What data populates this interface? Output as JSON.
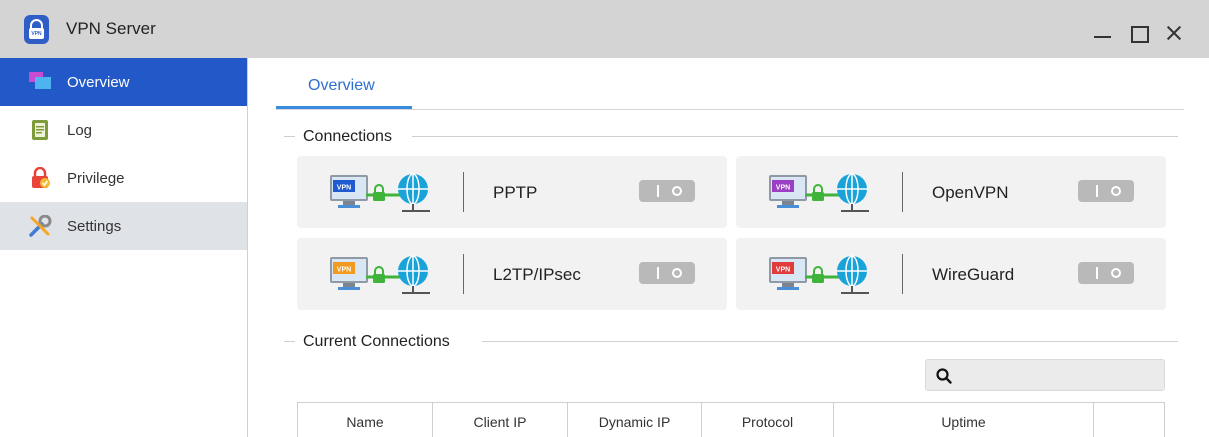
{
  "window": {
    "title": "VPN Server",
    "app_icon_text": "VPN"
  },
  "sidebar": {
    "items": [
      {
        "label": "Overview",
        "icon": "overview-icon",
        "state": "active"
      },
      {
        "label": "Log",
        "icon": "log-icon",
        "state": "normal"
      },
      {
        "label": "Privilege",
        "icon": "privilege-icon",
        "state": "normal"
      },
      {
        "label": "Settings",
        "icon": "settings-icon",
        "state": "hover"
      }
    ]
  },
  "tabs": [
    {
      "label": "Overview",
      "active": true
    }
  ],
  "connections": {
    "title": "Connections",
    "items": [
      {
        "protocol": "PPTP",
        "badge_text": "VPN",
        "badge_color": "#1f5bd0",
        "enabled": false
      },
      {
        "protocol": "OpenVPN",
        "badge_text": "VPN",
        "badge_color": "#9b3fc4",
        "enabled": false
      },
      {
        "protocol": "L2TP/IPsec",
        "badge_text": "VPN",
        "badge_color": "#f29a1f",
        "enabled": false
      },
      {
        "protocol": "WireGuard",
        "badge_text": "VPN",
        "badge_color": "#e23b3b",
        "enabled": false
      }
    ]
  },
  "current_connections": {
    "title": "Current Connections",
    "search": {
      "value": "",
      "placeholder": ""
    },
    "columns": [
      "Name",
      "Client IP",
      "Dynamic IP",
      "Protocol",
      "Uptime",
      ""
    ]
  },
  "colors": {
    "accent": "#2358c9",
    "tab_accent": "#3a8be0",
    "titlebar": "#d4d4d4",
    "globe": "#1aa3d9",
    "lock": "#3fb33a"
  }
}
